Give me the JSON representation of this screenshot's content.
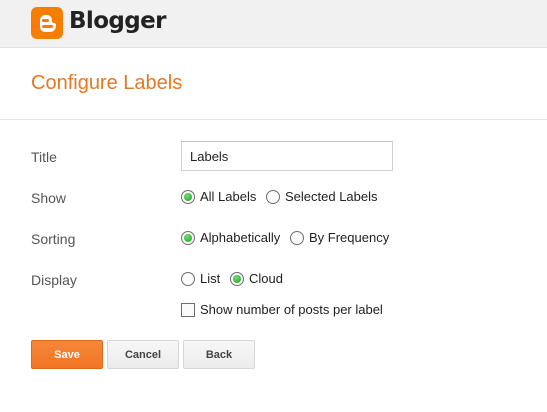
{
  "header": {
    "brand": "Blogger",
    "logo_icon": "blogger-logo-icon",
    "brand_color": "#f57d00"
  },
  "page": {
    "title": "Configure Labels",
    "title_color": "#e87722"
  },
  "form": {
    "title": {
      "label": "Title",
      "value": "Labels"
    },
    "show": {
      "label": "Show",
      "options": [
        {
          "label": "All Labels",
          "selected": true
        },
        {
          "label": "Selected Labels",
          "selected": false
        }
      ]
    },
    "sorting": {
      "label": "Sorting",
      "options": [
        {
          "label": "Alphabetically",
          "selected": true
        },
        {
          "label": "By Frequency",
          "selected": false
        }
      ]
    },
    "display": {
      "label": "Display",
      "options": [
        {
          "label": "List",
          "selected": false
        },
        {
          "label": "Cloud",
          "selected": true
        }
      ],
      "show_count": {
        "label": "Show number of posts per label",
        "checked": false
      }
    }
  },
  "buttons": {
    "save": "Save",
    "cancel": "Cancel",
    "back": "Back",
    "save_color": "#f07624"
  }
}
